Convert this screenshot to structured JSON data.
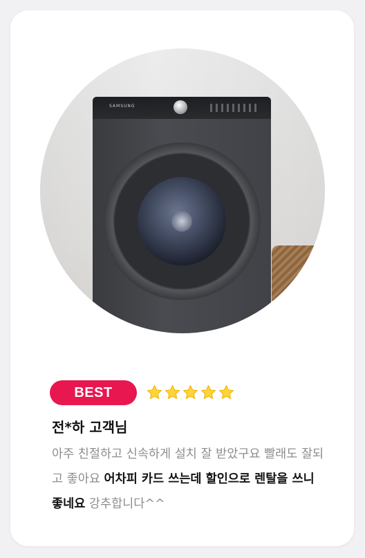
{
  "review": {
    "badge": "BEST",
    "rating": 5,
    "customer": "전*하 고객님",
    "text_part1": "아주 친절하고 신속하게 설치 잘 받았구요 빨래도 잘되고 좋아요 ",
    "text_highlight": "어차피 카드 쓰는데 할인으로 렌탈을 쓰니 좋네요",
    "text_part2": " 강추합니다^^"
  },
  "product_image": {
    "brand": "SAMSUNG",
    "subject": "washing-machine"
  },
  "colors": {
    "badge_bg": "#e8174f",
    "star_fill": "#ffd33a",
    "muted_text": "#8d8d8d",
    "strong_text": "#111111"
  }
}
